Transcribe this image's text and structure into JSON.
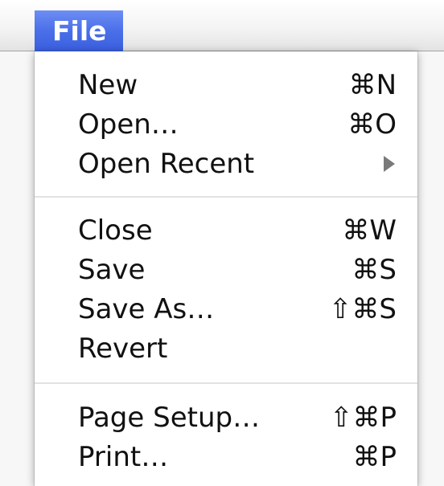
{
  "menubar": {
    "title": "File"
  },
  "menu": {
    "groups": [
      {
        "items": [
          {
            "label": "New",
            "shortcut": "⌘N"
          },
          {
            "label": "Open…",
            "shortcut": "⌘O"
          },
          {
            "label": "Open Recent",
            "submenu_icon": "submenu-arrow-icon"
          }
        ]
      },
      {
        "items": [
          {
            "label": "Close",
            "shortcut": "⌘W"
          },
          {
            "label": "Save",
            "shortcut": "⌘S"
          },
          {
            "label": "Save As…",
            "shortcut": "⇧⌘S"
          },
          {
            "label": "Revert",
            "shortcut": ""
          }
        ]
      },
      {
        "items": [
          {
            "label": "Page Setup…",
            "shortcut": "⇧⌘P"
          },
          {
            "label": "Print…",
            "shortcut": "⌘P"
          }
        ]
      }
    ]
  },
  "colors": {
    "selection_blue": "#4a6fe9",
    "text": "#111111",
    "separator": "#e2e2e2"
  }
}
